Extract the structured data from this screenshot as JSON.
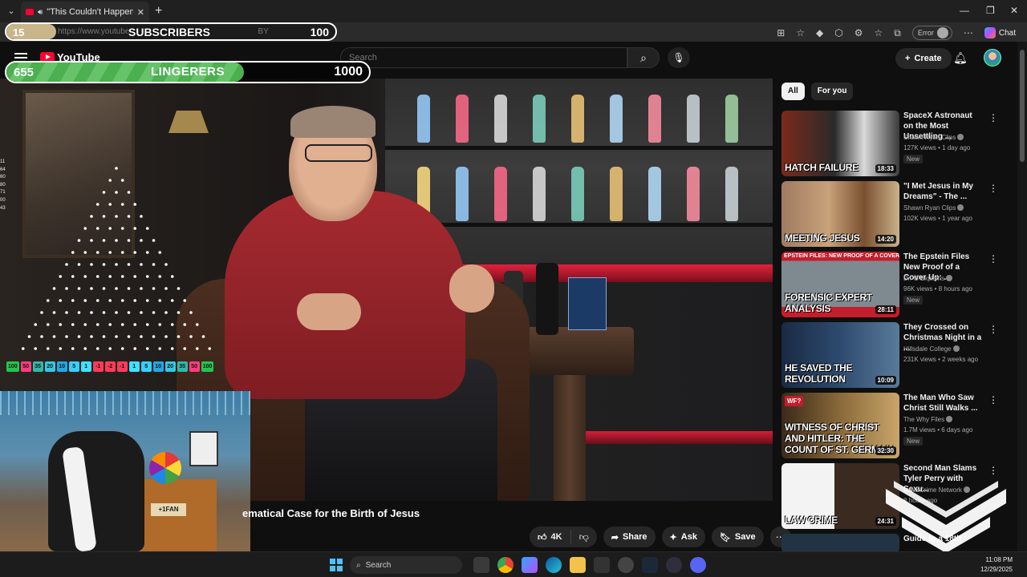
{
  "browser": {
    "tab_title": "\"This Couldn't Happen by Ch",
    "url": "https://www.youtube",
    "url_suffix": "BY",
    "error_label": "Error",
    "chat_label": "Chat"
  },
  "overlay": {
    "subscribers": {
      "count": "15",
      "label": "SUBSCRIBERS",
      "goal": "100",
      "progress": 0.15
    },
    "lingerers": {
      "count": "655",
      "label": "LINGERERS",
      "goal": "1000",
      "progress": 0.655
    },
    "plinko_side_numbers": [
      "11",
      "64",
      "60",
      "80",
      "71",
      "00",
      "43"
    ],
    "plinko_slots": [
      {
        "v": "100",
        "c": "#23c552"
      },
      {
        "v": "50",
        "c": "#ff3d7f"
      },
      {
        "v": "35",
        "c": "#2fb9a8"
      },
      {
        "v": "20",
        "c": "#36c7e0"
      },
      {
        "v": "10",
        "c": "#22a8e6"
      },
      {
        "v": "5",
        "c": "#35d0ff"
      },
      {
        "v": "1",
        "c": "#3fe1ff"
      },
      {
        "v": "-1",
        "c": "#ff3b5c"
      },
      {
        "v": "-2",
        "c": "#ff3b5c"
      },
      {
        "v": "-1",
        "c": "#ff3b5c"
      },
      {
        "v": "1",
        "c": "#3fe1ff"
      },
      {
        "v": "5",
        "c": "#35d0ff"
      },
      {
        "v": "10",
        "c": "#22a8e6"
      },
      {
        "v": "20",
        "c": "#36c7e0"
      },
      {
        "v": "35",
        "c": "#2fb9a8"
      },
      {
        "v": "50",
        "c": "#ff3d7f"
      },
      {
        "v": "100",
        "c": "#23c552"
      }
    ],
    "webcam_sign": "+1FAN"
  },
  "youtube": {
    "logo_text": "YouTube",
    "search_placeholder": "Search",
    "create_label": "Create",
    "video_title": "ematical Case for the Birth of Jesus",
    "actions": {
      "likes": "4K",
      "share": "Share",
      "ask": "Ask",
      "save": "Save"
    },
    "chips": [
      {
        "label": "All"
      },
      {
        "label": "For you"
      }
    ],
    "recommendations": [
      {
        "title": "SpaceX Astronaut on the Most Unsettling ...",
        "channel": "Shawn Ryan Clips",
        "meta": "127K views • 1 day ago",
        "badge": "New",
        "duration": "18:33",
        "thumb_text": "HATCH FAILURE",
        "thumb_bg": "linear-gradient(90deg,#7a2a1a,#2a2a2a 45%,#d9d9d9 70%,#3a3a3a)"
      },
      {
        "title": "\"I Met Jesus in My Dreams\" - The ...",
        "channel": "Shawn Ryan Clips",
        "meta": "102K views • 1 year ago",
        "badge": "",
        "duration": "14:20",
        "thumb_text": "MEETING JESUS",
        "thumb_bg": "linear-gradient(90deg,#a07a60,#c8a27a 40%,#7a5030 70%,#c9b28a)"
      },
      {
        "title": "The Epstein Files New Proof of a Cover Up: ...",
        "channel": "Dr. G Explains",
        "meta": "96K views • 8 hours ago",
        "badge": "New",
        "duration": "28:11",
        "thumb_text": "FORENSIC EXPERT ANALYSIS",
        "thumb_bg": "linear-gradient(180deg,#c41d2b 0 14%,#7f8a90 14% 84%,#c41d2b 84%)",
        "thumb_top_text": "EPSTEIN FILES: NEW PROOF OF A COVER-UP"
      },
      {
        "title": "They Crossed on Christmas Night in a ...",
        "channel": "Hillsdale College",
        "meta": "231K views • 2 weeks ago",
        "badge": "",
        "duration": "10:09",
        "thumb_text": "HE SAVED THE REVOLUTION",
        "thumb_bg": "linear-gradient(90deg,#1a2a44,#2d4b6e 50%,#5a7a9a)"
      },
      {
        "title": "The Man Who Saw Christ Still Walks ...",
        "channel": "The Why Files",
        "meta": "1.7M views • 6 days ago",
        "badge": "New",
        "duration": "32:30",
        "thumb_text": "WITNESS OF CHRIST AND HITLER: THE COUNT OF ST. GERMAIN",
        "thumb_bg": "linear-gradient(90deg,#3a2a1a,#8a6a3a 50%,#c9a56a)",
        "thumb_corner": "WF?"
      },
      {
        "title": "Second Man Slams Tyler Perry with Sexu...",
        "channel": "Law&Crime Network",
        "meta": "8 hours ago",
        "badge": "",
        "duration": "24:31",
        "thumb_text": "LAW CRIME",
        "thumb_bg": "linear-gradient(90deg,#f3f3f3 0 45%,#3a2a20 45%)"
      }
    ],
    "partial_item_text": "Guide to a 18th"
  },
  "taskbar": {
    "search_label": "Search",
    "time": "11:08 PM",
    "date": "12/29/2025"
  },
  "colors": {
    "accent_red": "#ff0033",
    "subs_fill": "#c9b58a",
    "ling_fill": "#4caf50"
  }
}
